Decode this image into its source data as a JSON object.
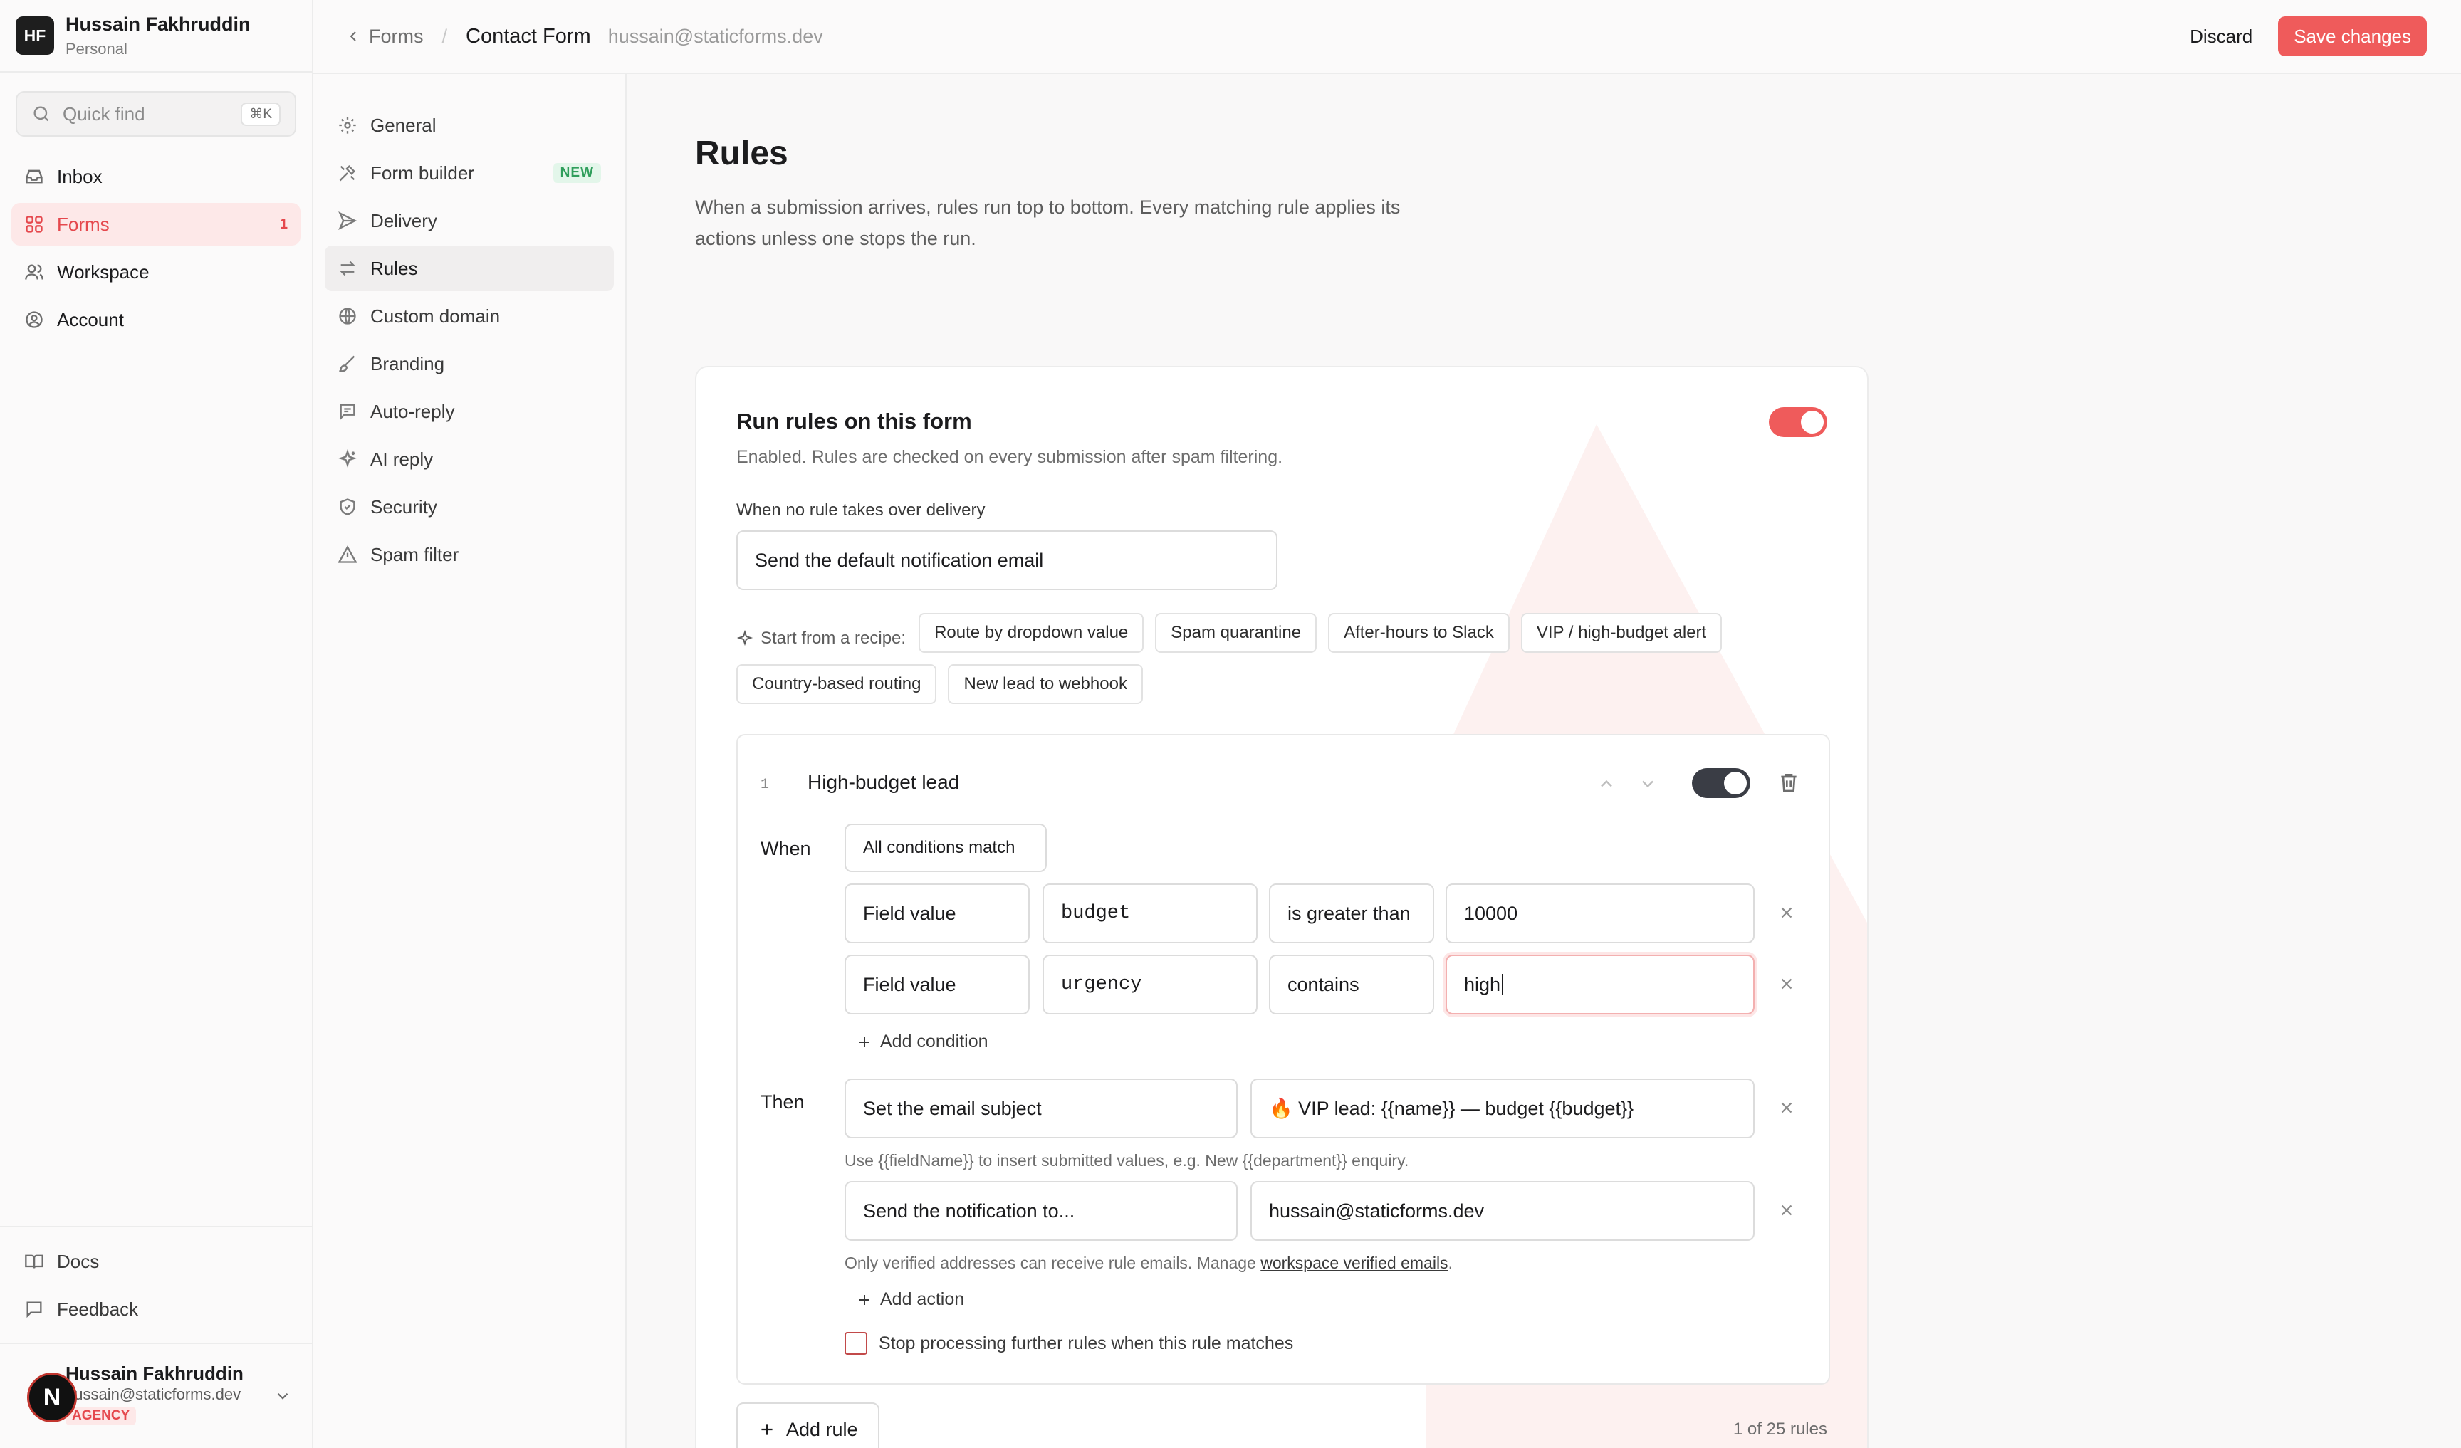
{
  "workspace": {
    "initials": "HF",
    "name": "Hussain Fakhruddin",
    "type": "Personal"
  },
  "quick_find": {
    "placeholder": "Quick find",
    "shortcut": "⌘K"
  },
  "nav": {
    "items": [
      {
        "label": "Inbox",
        "icon": "inbox-icon"
      },
      {
        "label": "Forms",
        "icon": "grid-icon",
        "badge": "1",
        "active": true
      },
      {
        "label": "Workspace",
        "icon": "users-icon"
      },
      {
        "label": "Account",
        "icon": "user-circle-icon"
      }
    ]
  },
  "bottom_links": [
    {
      "label": "Docs",
      "icon": "book-icon"
    },
    {
      "label": "Feedback",
      "icon": "message-icon"
    }
  ],
  "user": {
    "avatar_letter": "N",
    "name": "Hussain Fakhruddin",
    "email": "hussain@staticforms.dev",
    "plan": "AGENCY"
  },
  "breadcrumb": {
    "back": "Forms",
    "current": "Contact Form",
    "email": "hussain@staticforms.dev"
  },
  "actions": {
    "discard": "Discard",
    "save": "Save changes"
  },
  "subnav": [
    {
      "label": "General",
      "icon": "gear-icon"
    },
    {
      "label": "Form builder",
      "icon": "tools-icon",
      "badge": "NEW"
    },
    {
      "label": "Delivery",
      "icon": "send-icon"
    },
    {
      "label": "Rules",
      "icon": "arrows-icon",
      "active": true
    },
    {
      "label": "Custom domain",
      "icon": "globe-icon"
    },
    {
      "label": "Branding",
      "icon": "brush-icon"
    },
    {
      "label": "Auto-reply",
      "icon": "reply-icon"
    },
    {
      "label": "AI reply",
      "icon": "sparkle-icon"
    },
    {
      "label": "Security",
      "icon": "shield-icon"
    },
    {
      "label": "Spam filter",
      "icon": "warning-icon"
    }
  ],
  "page": {
    "title": "Rules",
    "description": "When a submission arrives, rules run top to bottom. Every matching rule applies its actions unless one stops the run."
  },
  "run_rules": {
    "title": "Run rules on this form",
    "description": "Enabled. Rules are checked on every submission after spam filtering.",
    "enabled": true,
    "fallback_label": "When no rule takes over delivery",
    "fallback_value": "Send the default notification email"
  },
  "recipes": {
    "lead": "Start from a recipe:",
    "items": [
      "Route by dropdown value",
      "Spam quarantine",
      "After-hours to Slack",
      "VIP / high-budget alert",
      "Country-based routing",
      "New lead to webhook"
    ]
  },
  "rule": {
    "index": "1",
    "name": "High-budget lead",
    "enabled": true,
    "when_label": "When",
    "match_mode": "All conditions match",
    "conditions": [
      {
        "source": "Field value",
        "field": "budget",
        "operator": "is greater than",
        "value": "10000"
      },
      {
        "source": "Field value",
        "field": "urgency",
        "operator": "contains",
        "value": "high"
      }
    ],
    "add_condition": "Add condition",
    "then_label": "Then",
    "actions": [
      {
        "type": "Set the email subject",
        "value": "🔥 VIP lead: {{name}} — budget {{budget}}",
        "hint": "Use {{fieldName}} to insert submitted values, e.g. New {{department}} enquiry."
      },
      {
        "type": "Send the notification to...",
        "value": "hussain@staticforms.dev",
        "hint_prefix": "Only verified addresses can receive rule emails. Manage ",
        "hint_link": "workspace verified emails",
        "hint_suffix": "."
      }
    ],
    "add_action": "Add action",
    "stop_processing_label": "Stop processing further rules when this rule matches",
    "stop_processing_checked": false
  },
  "footer": {
    "add_rule": "Add rule",
    "count": "1 of 25 rules"
  },
  "colors": {
    "accent": "#ef5b5b",
    "accent_light": "#fde8e8",
    "toggle_dark": "#3a3d45"
  }
}
